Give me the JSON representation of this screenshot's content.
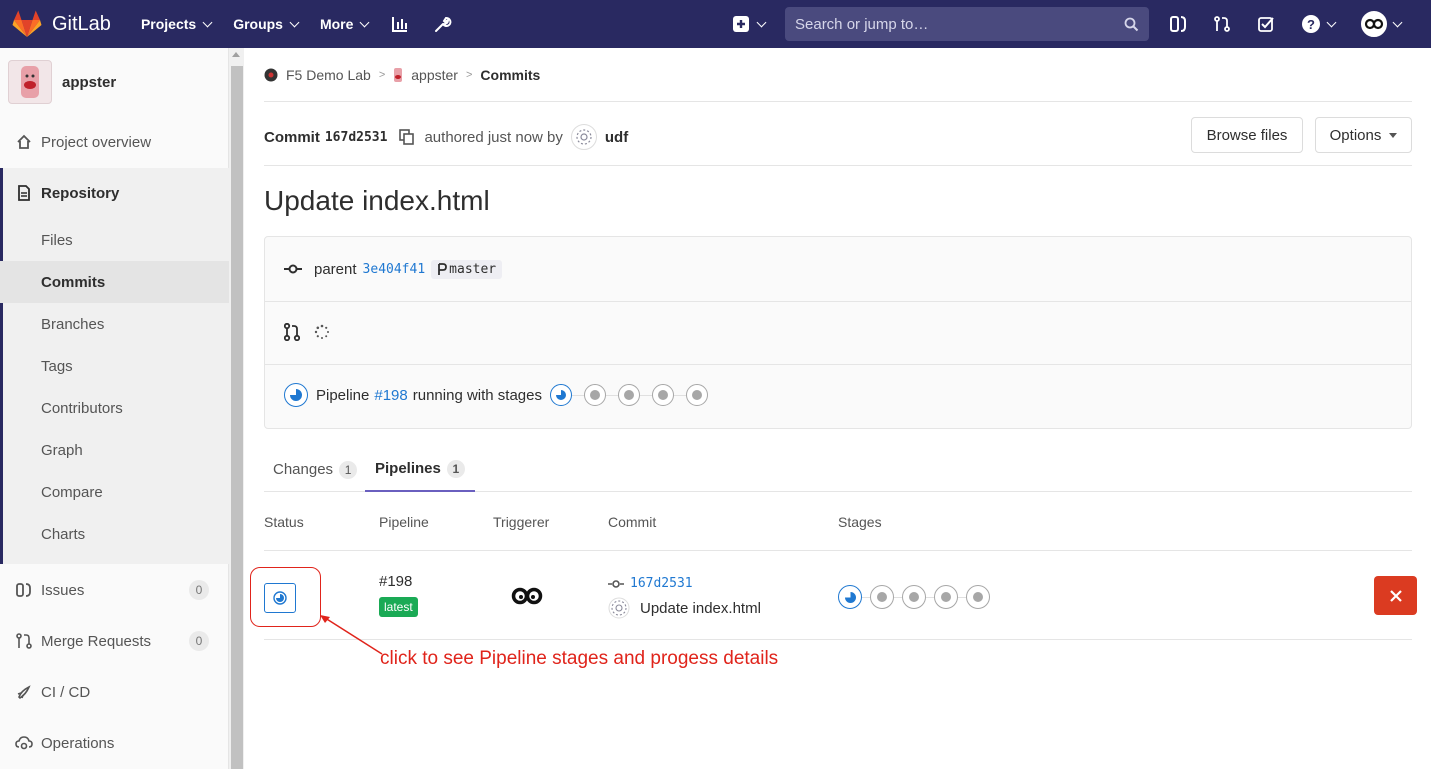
{
  "navbar": {
    "brand": "GitLab",
    "menu": [
      {
        "label": "Projects"
      },
      {
        "label": "Groups"
      },
      {
        "label": "More"
      }
    ],
    "search_placeholder": "Search or jump to…"
  },
  "sidebar": {
    "project_name": "appster",
    "project_overview": "Project overview",
    "repository": "Repository",
    "repo_items": [
      "Files",
      "Commits",
      "Branches",
      "Tags",
      "Contributors",
      "Graph",
      "Compare",
      "Charts"
    ],
    "issues": {
      "label": "Issues",
      "count": "0"
    },
    "merge_requests": {
      "label": "Merge Requests",
      "count": "0"
    },
    "cicd": "CI / CD",
    "operations": "Operations"
  },
  "breadcrumb": {
    "group": "F5 Demo Lab",
    "project": "appster",
    "current": "Commits"
  },
  "commit": {
    "label": "Commit",
    "sha": "167d2531",
    "authored": "authored just now by",
    "author": "udf",
    "browse_files": "Browse files",
    "options": "Options",
    "title": "Update index.html",
    "parent_label": "parent",
    "parent_sha": "3e404f41",
    "branch": "master",
    "pipeline_prefix": "Pipeline",
    "pipeline_id": "#198",
    "pipeline_suffix": "running with stages"
  },
  "tabs": [
    {
      "label": "Changes",
      "count": "1"
    },
    {
      "label": "Pipelines",
      "count": "1"
    }
  ],
  "table": {
    "headers": [
      "Status",
      "Pipeline",
      "Triggerer",
      "Commit",
      "Stages"
    ],
    "row": {
      "pipeline_id": "#198",
      "badge": "latest",
      "commit_sha": "167d2531",
      "commit_message": "Update index.html"
    }
  },
  "annotation": "click to see  Pipeline stages and progess details",
  "colors": {
    "navbar": "#292961",
    "link": "#1f78d1",
    "success": "#1aaa55",
    "danger": "#db3b21",
    "annotation": "#e0241b"
  }
}
